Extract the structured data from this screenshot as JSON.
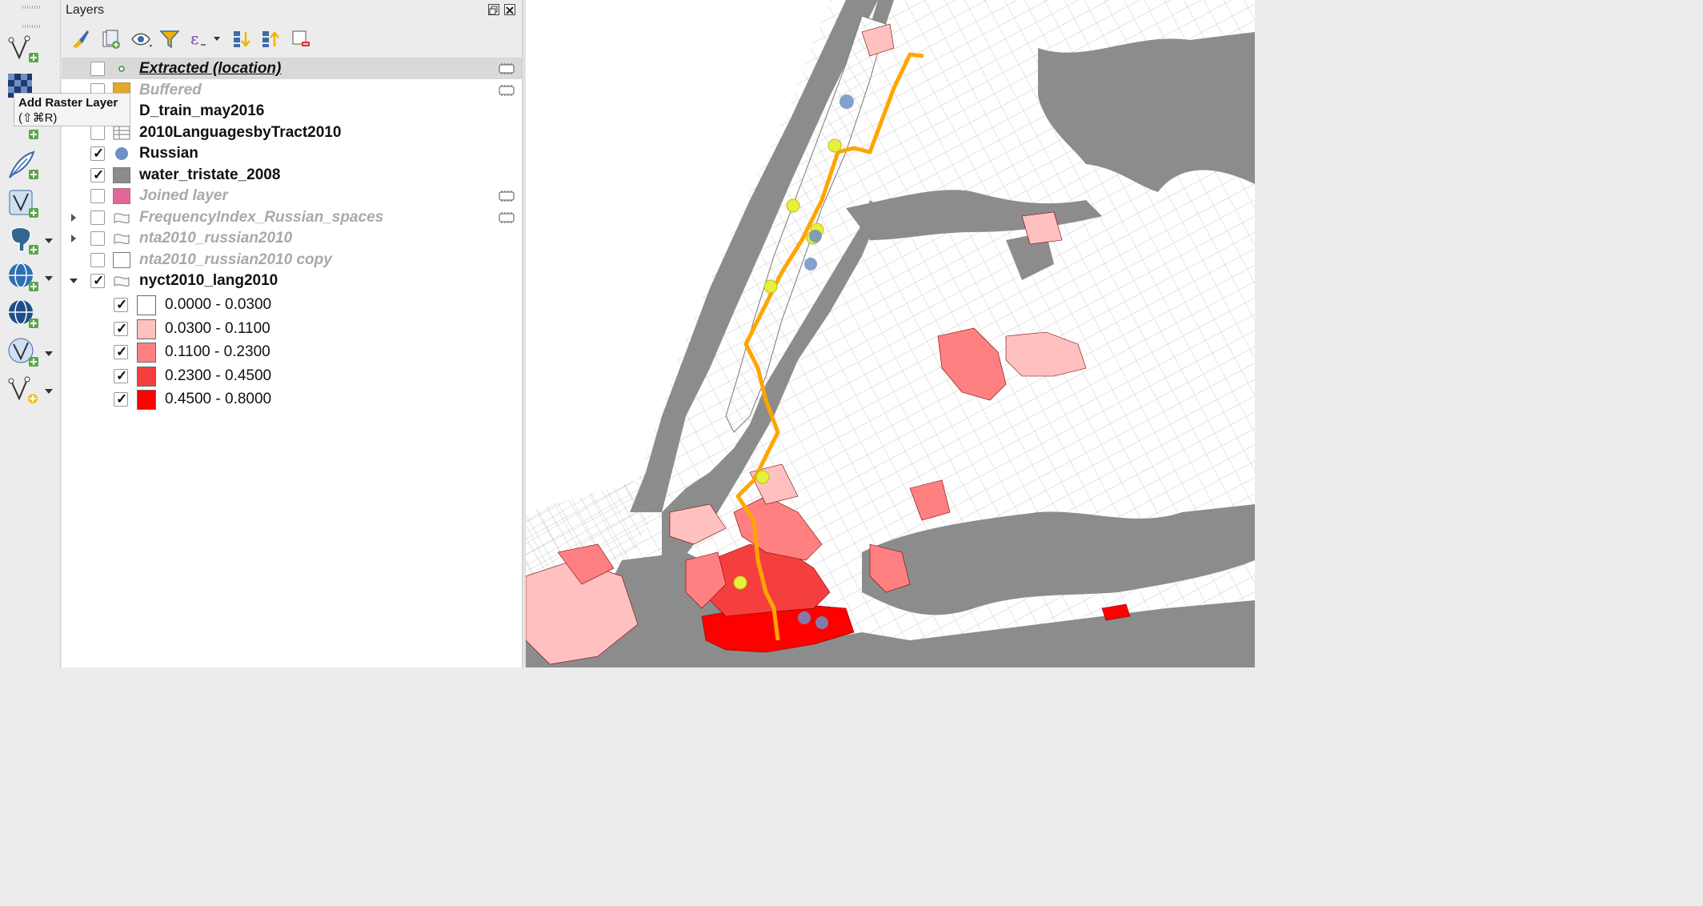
{
  "toolbar": {
    "tooltip": {
      "title": "Add Raster Layer",
      "shortcut": "(⇧⌘R)"
    },
    "buttons": [
      {
        "name": "add-vector-layer-button",
        "icon": "vector-add-icon",
        "has_menu": false
      },
      {
        "name": "add-raster-layer-button",
        "icon": "raster-add-icon",
        "has_menu": false
      },
      {
        "name": "add-delimited-text-button",
        "icon": "delimited-text-icon",
        "has_menu": false
      },
      {
        "name": "new-spatialite-button",
        "icon": "feather-icon",
        "has_menu": false
      },
      {
        "name": "add-virtual-layer-button",
        "icon": "virtual-layer-icon",
        "has_menu": false
      },
      {
        "name": "add-postgis-button",
        "icon": "elephant-icon",
        "has_menu": true
      },
      {
        "name": "add-wms-button",
        "icon": "globe-add-icon",
        "has_menu": true
      },
      {
        "name": "add-wfs-button",
        "icon": "globe-icon",
        "has_menu": false
      },
      {
        "name": "add-vector-tile-button",
        "icon": "vector-tile-icon",
        "has_menu": true
      },
      {
        "name": "new-temporary-layer-button",
        "icon": "vector-new-icon",
        "has_menu": true
      }
    ]
  },
  "panel": {
    "title": "Layers",
    "tools": [
      "style-brush-icon",
      "add-group-icon",
      "eye-icon",
      "filter-icon",
      "expression-icon",
      "expand-all-icon",
      "collapse-all-icon",
      "remove-layer-icon"
    ]
  },
  "layers": [
    {
      "label": "Extracted (location)",
      "checked": false,
      "visible": true,
      "style": "selected",
      "symbol": "point-green",
      "embedded": true,
      "expander": "none"
    },
    {
      "label": "Buffered",
      "checked": false,
      "visible": false,
      "style": "inactive",
      "symbol": "fill-yellow",
      "embedded": true,
      "expander": "none"
    },
    {
      "label": "D_train_may2016",
      "checked": false,
      "visible": true,
      "style": "normal",
      "symbol": "none",
      "embedded": false,
      "expander": "none"
    },
    {
      "label": "2010LanguagesbyTract2010",
      "checked": false,
      "visible": true,
      "style": "normal",
      "symbol": "table",
      "embedded": false,
      "expander": "none"
    },
    {
      "label": "Russian",
      "checked": true,
      "visible": true,
      "style": "normal",
      "symbol": "point-blue",
      "embedded": false,
      "expander": "none"
    },
    {
      "label": "water_tristate_2008",
      "checked": true,
      "visible": true,
      "style": "normal",
      "symbol": "fill-gray",
      "embedded": false,
      "expander": "none"
    },
    {
      "label": "Joined layer",
      "checked": false,
      "visible": false,
      "style": "inactive",
      "symbol": "fill-pink",
      "embedded": true,
      "expander": "none"
    },
    {
      "label": "FrequencyIndex_Russian_spaces",
      "checked": false,
      "visible": false,
      "style": "inactive",
      "symbol": "polygon-outline",
      "embedded": true,
      "expander": "closed"
    },
    {
      "label": "nta2010_russian2010",
      "checked": false,
      "visible": false,
      "style": "inactive",
      "symbol": "polygon-outline",
      "embedded": false,
      "expander": "closed"
    },
    {
      "label": "nta2010_russian2010 copy",
      "checked": false,
      "visible": false,
      "style": "inactive",
      "symbol": "fill-white",
      "embedded": false,
      "expander": "none"
    },
    {
      "label": "nyct2010_lang2010",
      "checked": true,
      "visible": true,
      "style": "normal",
      "symbol": "polygon-outline",
      "embedded": false,
      "expander": "open"
    }
  ],
  "legend": [
    {
      "label": "0.0000 - 0.0300",
      "color": "#ffffff",
      "checked": true
    },
    {
      "label": "0.0300 - 0.1100",
      "color": "#ffc0c0",
      "checked": true
    },
    {
      "label": "0.1100 - 0.2300",
      "color": "#ff8080",
      "checked": true
    },
    {
      "label": "0.2300 - 0.4500",
      "color": "#f53f3f",
      "checked": true
    },
    {
      "label": "0.4500 - 0.8000",
      "color": "#ff0000",
      "checked": true
    }
  ],
  "map_colors": {
    "water": "#8c8c8c",
    "land": "#ffffff",
    "route": "#ffa500",
    "stations": "#e8f03c",
    "russian_points": "#6f8fc7"
  }
}
